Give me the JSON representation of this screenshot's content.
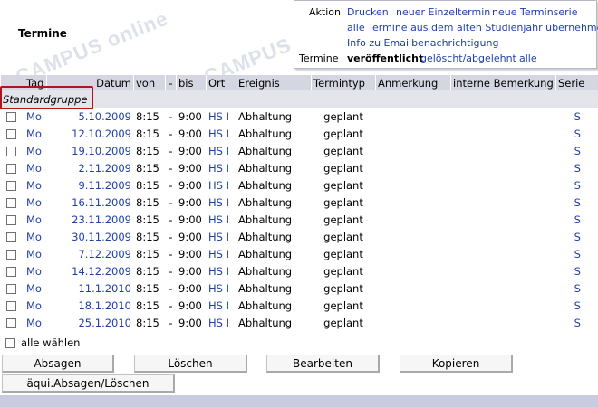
{
  "page": {
    "title": "Termine",
    "watermark": "CAMPUS online"
  },
  "actions": {
    "label": "Aktion",
    "print": "Drucken",
    "new_single": "neuer Einzeltermin",
    "new_series": "neue Terminserie",
    "take_over": "alle Termine aus dem alten Studienjahr übernehmen",
    "email_info": "Info zu Emailbenachrichtigung",
    "filter_label": "Termine",
    "filter_published": "veröffentlicht",
    "filter_deleted": "gelöscht/abgelehnt",
    "filter_all": "alle"
  },
  "table": {
    "headers": {
      "tag": "Tag",
      "datum": "Datum",
      "von": "von",
      "dash": "-",
      "bis": "bis",
      "ort": "Ort",
      "ereignis": "Ereignis",
      "termintyp": "Termintyp",
      "anmerkung": "Anmerkung",
      "interne": "interne Bemerkung",
      "serie": "Serie"
    },
    "group": "Standardgruppe",
    "rows": [
      {
        "tag": "Mo",
        "datum": "5.10.2009",
        "von": "8:15",
        "dash": "-",
        "bis": "9:00",
        "ort": "HS I",
        "ereignis": "Abhaltung",
        "typ": "geplant",
        "serie": "S"
      },
      {
        "tag": "Mo",
        "datum": "12.10.2009",
        "von": "8:15",
        "dash": "-",
        "bis": "9:00",
        "ort": "HS I",
        "ereignis": "Abhaltung",
        "typ": "geplant",
        "serie": "S"
      },
      {
        "tag": "Mo",
        "datum": "19.10.2009",
        "von": "8:15",
        "dash": "-",
        "bis": "9:00",
        "ort": "HS I",
        "ereignis": "Abhaltung",
        "typ": "geplant",
        "serie": "S"
      },
      {
        "tag": "Mo",
        "datum": "2.11.2009",
        "von": "8:15",
        "dash": "-",
        "bis": "9:00",
        "ort": "HS I",
        "ereignis": "Abhaltung",
        "typ": "geplant",
        "serie": "S"
      },
      {
        "tag": "Mo",
        "datum": "9.11.2009",
        "von": "8:15",
        "dash": "-",
        "bis": "9:00",
        "ort": "HS I",
        "ereignis": "Abhaltung",
        "typ": "geplant",
        "serie": "S"
      },
      {
        "tag": "Mo",
        "datum": "16.11.2009",
        "von": "8:15",
        "dash": "-",
        "bis": "9:00",
        "ort": "HS I",
        "ereignis": "Abhaltung",
        "typ": "geplant",
        "serie": "S"
      },
      {
        "tag": "Mo",
        "datum": "23.11.2009",
        "von": "8:15",
        "dash": "-",
        "bis": "9:00",
        "ort": "HS I",
        "ereignis": "Abhaltung",
        "typ": "geplant",
        "serie": "S"
      },
      {
        "tag": "Mo",
        "datum": "30.11.2009",
        "von": "8:15",
        "dash": "-",
        "bis": "9:00",
        "ort": "HS I",
        "ereignis": "Abhaltung",
        "typ": "geplant",
        "serie": "S"
      },
      {
        "tag": "Mo",
        "datum": "7.12.2009",
        "von": "8:15",
        "dash": "-",
        "bis": "9:00",
        "ort": "HS I",
        "ereignis": "Abhaltung",
        "typ": "geplant",
        "serie": "S"
      },
      {
        "tag": "Mo",
        "datum": "14.12.2009",
        "von": "8:15",
        "dash": "-",
        "bis": "9:00",
        "ort": "HS I",
        "ereignis": "Abhaltung",
        "typ": "geplant",
        "serie": "S"
      },
      {
        "tag": "Mo",
        "datum": "11.1.2010",
        "von": "8:15",
        "dash": "-",
        "bis": "9:00",
        "ort": "HS I",
        "ereignis": "Abhaltung",
        "typ": "geplant",
        "serie": "S"
      },
      {
        "tag": "Mo",
        "datum": "18.1.2010",
        "von": "8:15",
        "dash": "-",
        "bis": "9:00",
        "ort": "HS I",
        "ereignis": "Abhaltung",
        "typ": "geplant",
        "serie": "S"
      },
      {
        "tag": "Mo",
        "datum": "25.1.2010",
        "von": "8:15",
        "dash": "-",
        "bis": "9:00",
        "ort": "HS I",
        "ereignis": "Abhaltung",
        "typ": "geplant",
        "serie": "S"
      }
    ],
    "select_all": "alle wählen"
  },
  "buttons": {
    "absagen": "Absagen",
    "loeschen": "Löschen",
    "bearbeiten": "Bearbeiten",
    "kopieren": "Kopieren",
    "aequi": "äqui.Absagen/Löschen"
  },
  "colors": {
    "header_bg": "#d4d7e1",
    "link": "#1f3fa8",
    "highlight": "#b0151b"
  }
}
